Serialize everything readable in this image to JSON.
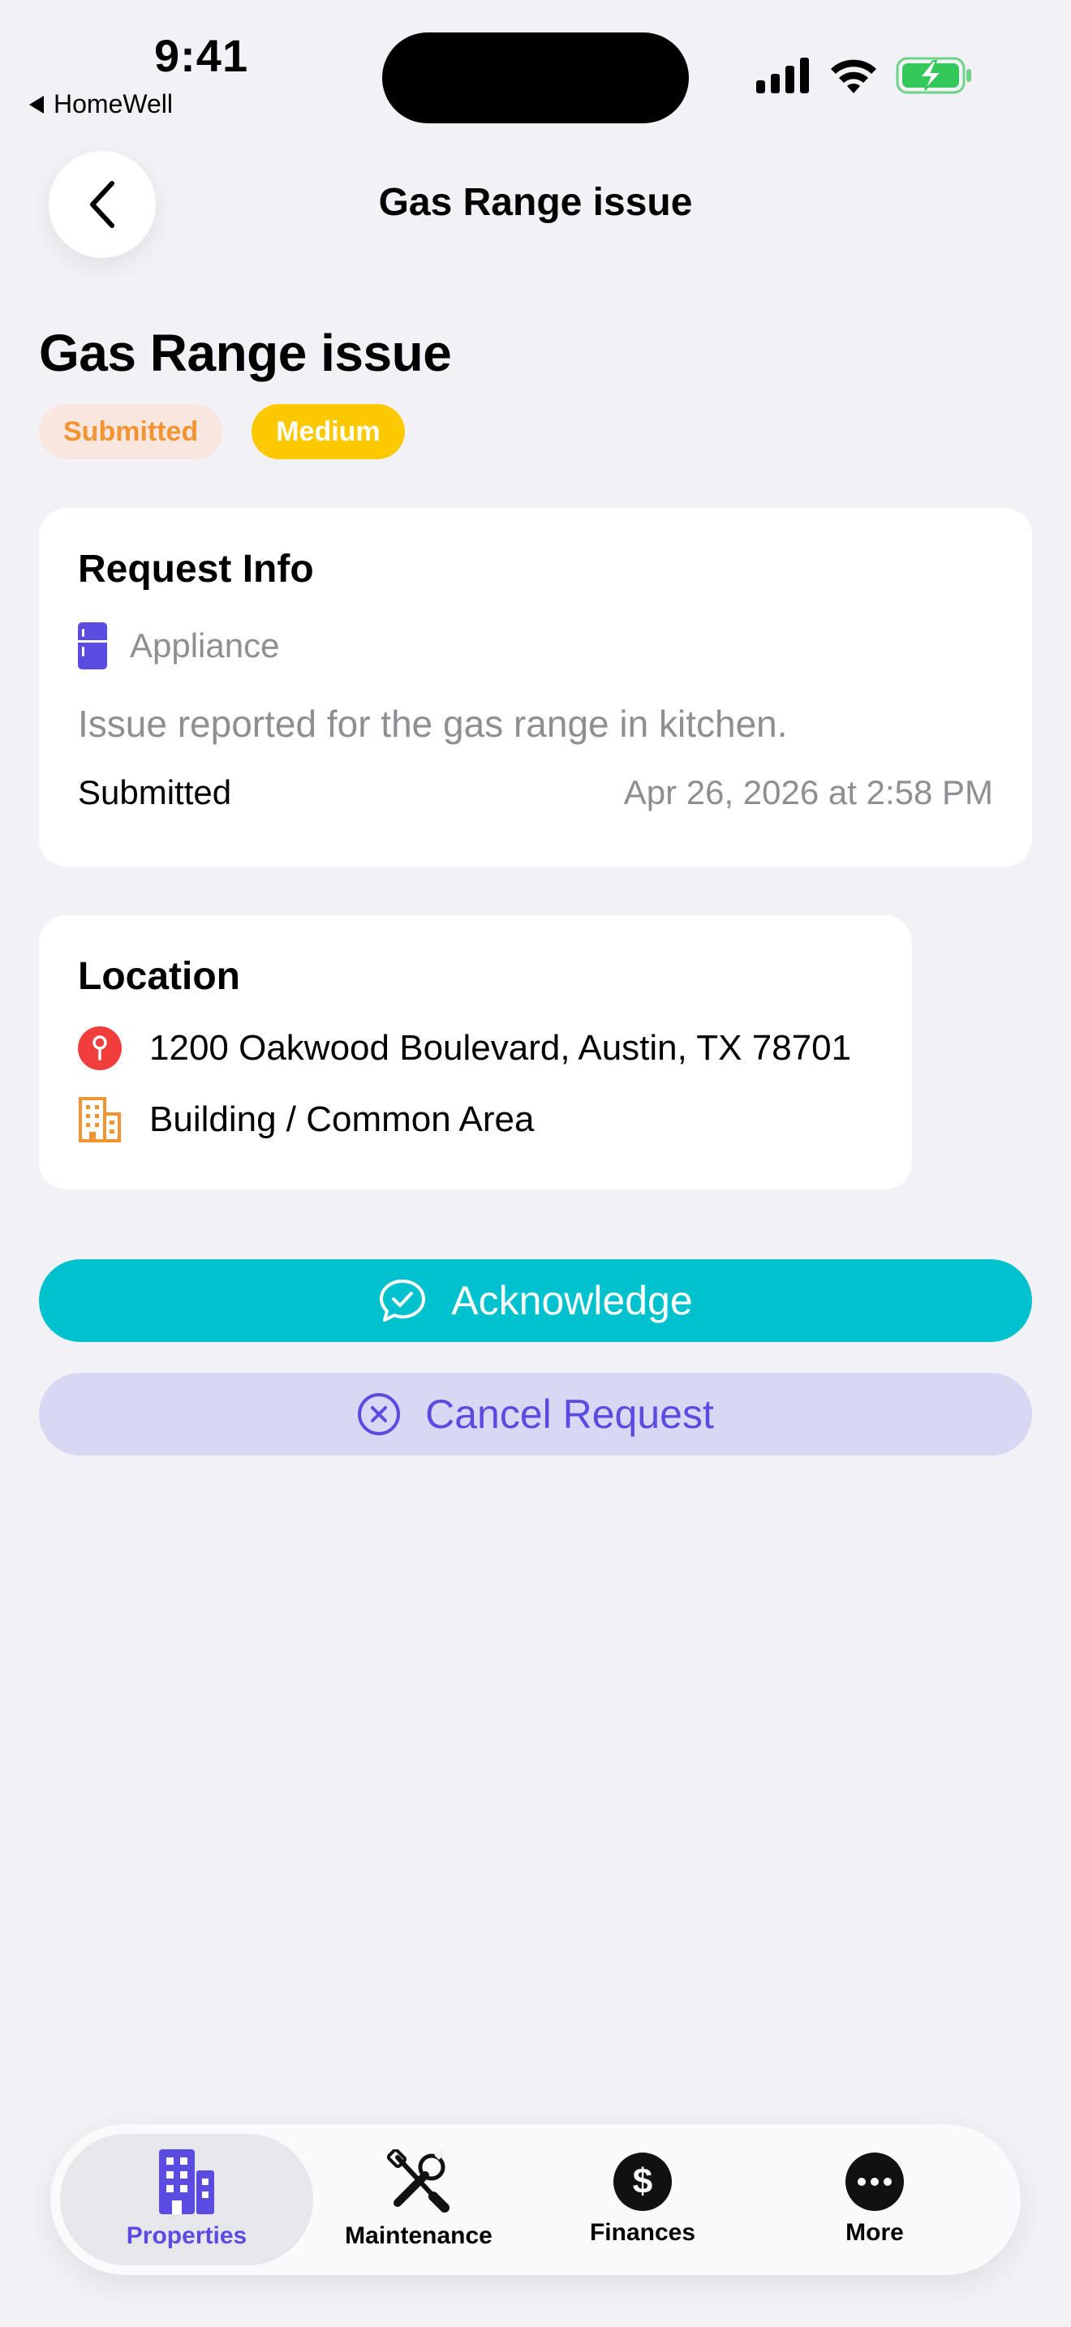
{
  "status_bar": {
    "time": "9:41",
    "back_app": "HomeWell"
  },
  "nav": {
    "title": "Gas Range issue"
  },
  "request": {
    "title": "Gas Range issue",
    "status_badge": "Submitted",
    "priority_badge": "Medium",
    "info_card": {
      "heading": "Request Info",
      "category": "Appliance",
      "description": "Issue reported for the gas range in kitchen.",
      "submitted_label": "Submitted",
      "submitted_date": "Apr 26, 2026 at 2:58 PM"
    },
    "location_card": {
      "heading": "Location",
      "address": "1200 Oakwood Boulevard, Austin, TX 78701",
      "area": "Building / Common Area"
    }
  },
  "actions": {
    "acknowledge": "Acknowledge",
    "cancel": "Cancel Request"
  },
  "tabbar": {
    "tabs": [
      {
        "label": "Properties",
        "icon": "building-icon",
        "active": true
      },
      {
        "label": "Maintenance",
        "icon": "wrench-screwdriver-icon",
        "active": false
      },
      {
        "label": "Finances",
        "icon": "dollar-circle-icon",
        "active": false
      },
      {
        "label": "More",
        "icon": "ellipsis-circle-icon",
        "active": false
      }
    ]
  },
  "colors": {
    "background": "#f1f1f6",
    "accent": "#5b4ce1",
    "acknowledge": "#00c2cf",
    "cancel_bg": "#d9d8f4",
    "submitted_badge_bg": "#f8e6df",
    "submitted_badge_text": "#f39432",
    "medium_badge": "#fcc900",
    "pin": "#f23d3d",
    "building_orange": "#f39432",
    "battery": "#34c759"
  }
}
